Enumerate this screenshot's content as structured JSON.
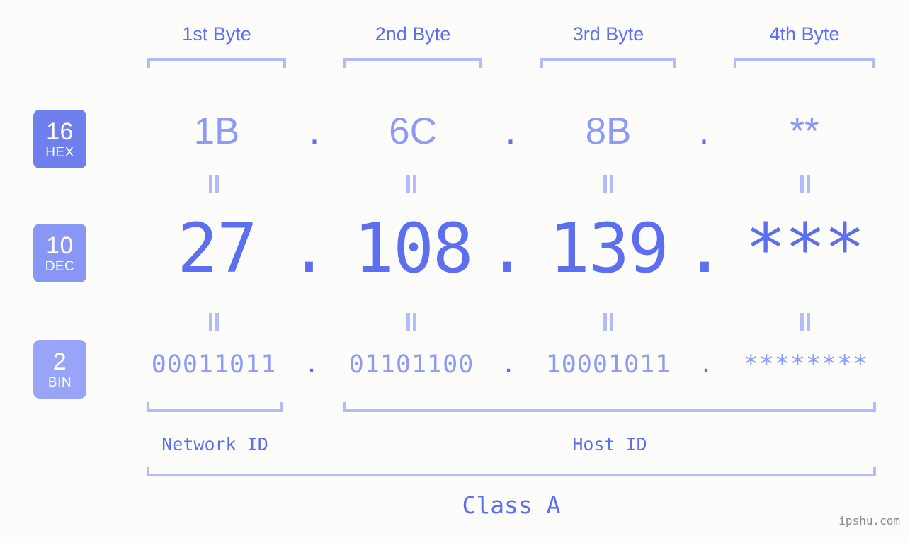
{
  "background_color": "#fcfdfa",
  "accent_color": "#5c6ff0",
  "accent_light_color": "#8d9bf7",
  "bracket_color": "#b3bcfb",
  "header": {
    "bytes": [
      {
        "label": "1st Byte"
      },
      {
        "label": "2nd Byte"
      },
      {
        "label": "3rd Byte"
      },
      {
        "label": "4th Byte"
      }
    ]
  },
  "bases": [
    {
      "num": "16",
      "name": "HEX",
      "color": "#6f7fee"
    },
    {
      "num": "10",
      "name": "DEC",
      "color": "#8896f5"
    },
    {
      "num": "2",
      "name": "BIN",
      "color": "#97a4f8"
    }
  ],
  "rows": {
    "hex": {
      "base_num": "16",
      "base_name": "HEX",
      "octets": [
        "1B",
        "6C",
        "8B",
        "**"
      ],
      "separators": [
        ".",
        ".",
        "."
      ]
    },
    "dec": {
      "base_num": "10",
      "base_name": "DEC",
      "octets": [
        "27",
        "108",
        "139",
        "***"
      ],
      "separators": [
        ".",
        ".",
        "."
      ]
    },
    "bin": {
      "base_num": "2",
      "base_name": "BIN",
      "octets": [
        "00011011",
        "01101100",
        "10001011",
        "********"
      ],
      "separators": [
        ".",
        ".",
        "."
      ]
    }
  },
  "equality_marks": {
    "glyph": "||",
    "count_per_row": 4
  },
  "footer": {
    "network_id_label": "Network ID",
    "host_id_label": "Host ID",
    "class_label": "Class A"
  },
  "watermark": "ipshu.com"
}
